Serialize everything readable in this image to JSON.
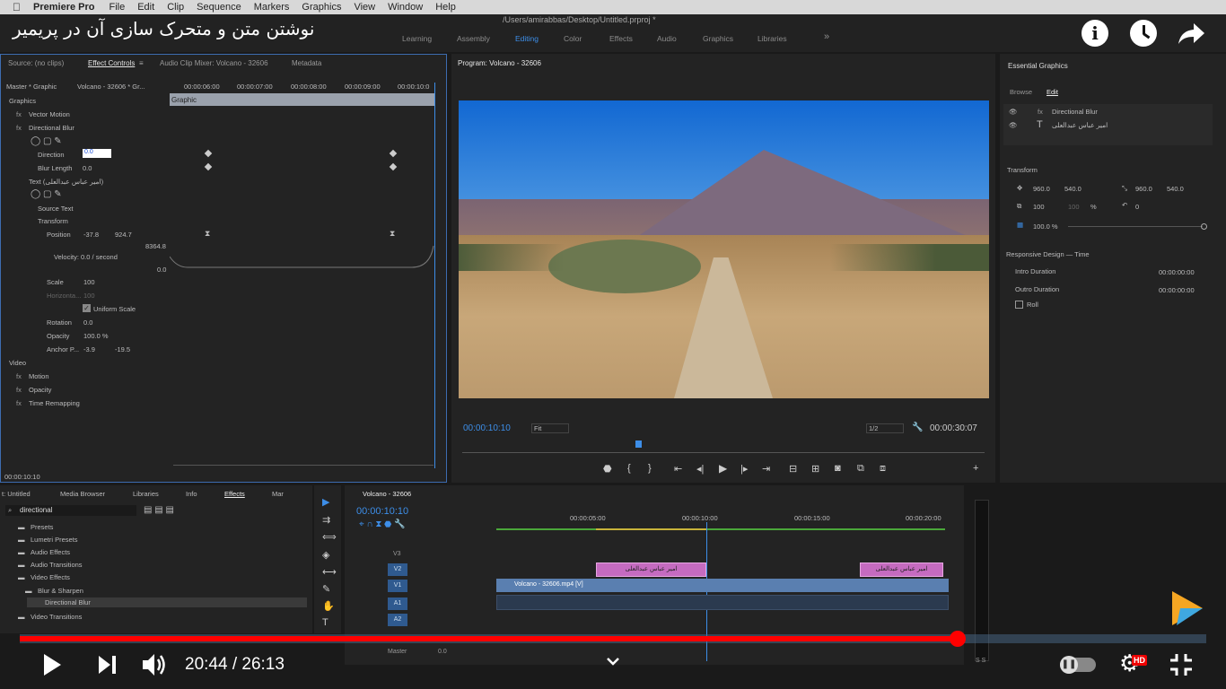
{
  "menubar": {
    "app": "Premiere Pro",
    "items": [
      "File",
      "Edit",
      "Clip",
      "Sequence",
      "Markers",
      "Graphics",
      "View",
      "Window",
      "Help"
    ]
  },
  "title_path": "/Users/amirabbas/Desktop/Untitled.prproj *",
  "video_title": "نوشتن متن و متحرک سازی آن در پریمیر",
  "workspaces": [
    "Learning",
    "Assembly",
    "Editing",
    "Color",
    "Effects",
    "Audio",
    "Graphics",
    "Libraries"
  ],
  "effect_controls": {
    "tabs": [
      "Source: (no clips)",
      "Effect Controls",
      "Audio Clip Mixer: Volcano - 32606",
      "Metadata"
    ],
    "master": "Master * Graphic",
    "seq": "Volcano - 32606 * Gr...",
    "times": [
      "00:00:06:00",
      "00:00:07:00",
      "00:00:08:00",
      "00:00:09:00",
      "00:00:10:0"
    ],
    "graphic_bar": "Graphic",
    "rows": [
      "Graphics",
      "Vector Motion",
      "Directional Blur",
      "Direction",
      "Blur Length",
      "Text (امیر عباس عبدالعلی)",
      "Source Text",
      "Transform",
      "Position",
      "Velocity: 0.0 / second",
      "Scale",
      "Horizonta...",
      "Uniform Scale",
      "Rotation",
      "Opacity",
      "Anchor P...",
      "Video",
      "Motion",
      "Opacity",
      "Time Remapping"
    ],
    "values": {
      "direction": "0.0",
      "blur_length": "0.0",
      "pos_x": "-37.8",
      "pos_y": "924.7",
      "v1": "8364.8",
      "v2": "0.0",
      "scale": "100",
      "horiz": "100",
      "rotation": "0.0",
      "opacity": "100.0 %",
      "anchor_x": "-3.9",
      "anchor_y": "-19.5"
    },
    "timecode": "00:00:10:10"
  },
  "program": {
    "title": "Program: Volcano - 32606",
    "timecode": "00:00:10:10",
    "fit": "Fit",
    "res": "1/2",
    "duration": "00:00:30:07"
  },
  "essential": {
    "title": "Essential Graphics",
    "tabs": [
      "Browse",
      "Edit"
    ],
    "layers": [
      "Directional Blur",
      "امیر عباس عبدالعلی"
    ],
    "transform_label": "Transform",
    "pos": [
      "960.0",
      "540.0"
    ],
    "anchor": [
      "960.0",
      "540.0"
    ],
    "scale": "100",
    "scale2": "100",
    "pct": "%",
    "rot": "0",
    "opacity": "100.0 %",
    "responsive": "Responsive Design — Time",
    "intro": "Intro Duration",
    "intro_val": "00:00:00:00",
    "outro": "Outro Duration",
    "outro_val": "00:00:00:00",
    "roll": "Roll"
  },
  "effects_panel": {
    "tabs": [
      "t: Untitled",
      "Media Browser",
      "Libraries",
      "Info",
      "Effects",
      "Mar"
    ],
    "search": "directional",
    "tree": [
      "Presets",
      "Lumetri Presets",
      "Audio Effects",
      "Audio Transitions",
      "Video Effects",
      "Blur & Sharpen",
      "Directional Blur",
      "Video Transitions"
    ]
  },
  "timeline": {
    "title": "Volcano - 32606",
    "timecode": "00:00:10:10",
    "ruler": [
      "00:00:05:00",
      "00:00:10:00",
      "00:00:15:00",
      "00:00:20:00"
    ],
    "tracks": [
      "V3",
      "V2",
      "V1",
      "A1",
      "A2"
    ],
    "clip_text": "امیر عباس عبدالعلی",
    "clip_v1": "Volcano - 32606.mp4 [V]",
    "master": "Master",
    "master_val": "0.0",
    "ss": "S S"
  },
  "player": {
    "time": "20:44 / 26:13",
    "progress": 0.79,
    "hd": "HD"
  }
}
